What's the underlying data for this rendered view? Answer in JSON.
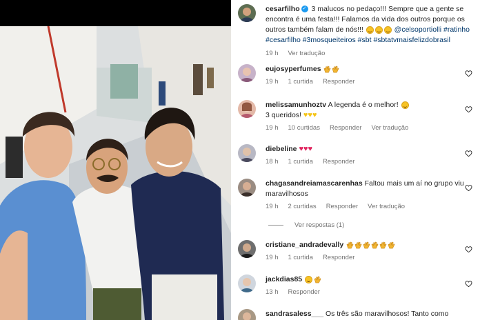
{
  "post": {
    "username": "cesarfilho",
    "caption_pre": "3 malucos no pedaço!!! Sempre que a gente se encontra é uma festa!!! Falamos da vida dos outros porque os outros também falam de nós!!!",
    "hashtags_line1": [
      "@celsoportiolli",
      "#ratinho"
    ],
    "hashtags_line2": [
      "#cesarfilho",
      "#3mosqueiteiros",
      "#sbt",
      "#sbtatvmaisfelizdobrasil"
    ],
    "time": "19 h",
    "translate": "Ver tradução"
  },
  "comments": [
    {
      "username": "eujosyperfumes",
      "text": "",
      "emojis": "clap2",
      "time": "19 h",
      "likes": "1 curtida",
      "reply": "Responder",
      "translate": ""
    },
    {
      "username": "melissamunhoztv",
      "text": "A legenda é o melhor!",
      "text2": "3 queridos!",
      "time": "19 h",
      "likes": "10 curtidas",
      "reply": "Responder",
      "translate": "Ver tradução"
    },
    {
      "username": "diebeline",
      "text": "",
      "time": "18 h",
      "likes": "1 curtida",
      "reply": "Responder",
      "translate": ""
    },
    {
      "username": "chagasandreiamascarenhas",
      "text": "Faltou mais um aí no grupo viu",
      "text2": "maravilhosos",
      "time": "19 h",
      "likes": "2 curtidas",
      "reply": "Responder",
      "translate": "Ver tradução",
      "view_replies": "Ver respostas (1)"
    },
    {
      "username": "cristiane_andradevally",
      "text": "",
      "time": "19 h",
      "likes": "1 curtida",
      "reply": "Responder",
      "translate": ""
    },
    {
      "username": "jackdias85",
      "text": "",
      "time": "13 h",
      "likes": "",
      "reply": "Responder",
      "translate": ""
    },
    {
      "username": "sandrasaless___",
      "text": "Os três são maravilhosos! Tanto como",
      "time": "",
      "likes": "",
      "reply": "",
      "translate": ""
    }
  ],
  "colors": {
    "link": "#00376b",
    "muted": "#737373",
    "verified": "#1d9bf0"
  },
  "icons": [
    "verified-badge-icon",
    "heart-outline-icon",
    "clap-emoji-icon",
    "heart-emoji-icon",
    "laughing-emoji-icon"
  ]
}
